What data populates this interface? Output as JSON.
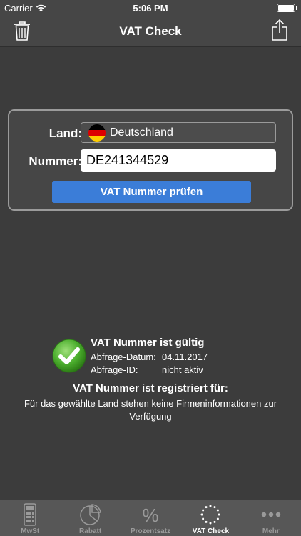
{
  "status_bar": {
    "carrier": "Carrier",
    "time": "5:06 PM"
  },
  "nav": {
    "title": "VAT Check",
    "left_icon": "trash-icon",
    "right_icon": "share-icon"
  },
  "form": {
    "land_label": "Land:",
    "country": "Deutschland",
    "nummer_label": "Nummer:",
    "number_value": "DE241344529",
    "check_button": "VAT Nummer prüfen"
  },
  "result": {
    "valid_title": "VAT Nummer ist gültig",
    "date_label": "Abfrage-Datum:",
    "date_value": "04.11.2017",
    "id_label": "Abfrage-ID:",
    "id_value": "nicht aktiv",
    "registered_title": "VAT Nummer ist registriert für:",
    "registered_text": "Für das gewählte Land stehen keine Firmeninformationen zur Verfügung"
  },
  "tabs": [
    {
      "label": "MwSt",
      "icon": "calculator-icon"
    },
    {
      "label": "Rabatt",
      "icon": "pie-chart-icon"
    },
    {
      "label": "Prozentsatz",
      "icon": "percent-icon"
    },
    {
      "label": "VAT Check",
      "icon": "eu-stars-icon",
      "active": true
    },
    {
      "label": "Mehr",
      "icon": "more-icon"
    }
  ],
  "colors": {
    "accent": "#3b7dd8",
    "background": "#3c3c3c",
    "success": "#4caf2e"
  }
}
